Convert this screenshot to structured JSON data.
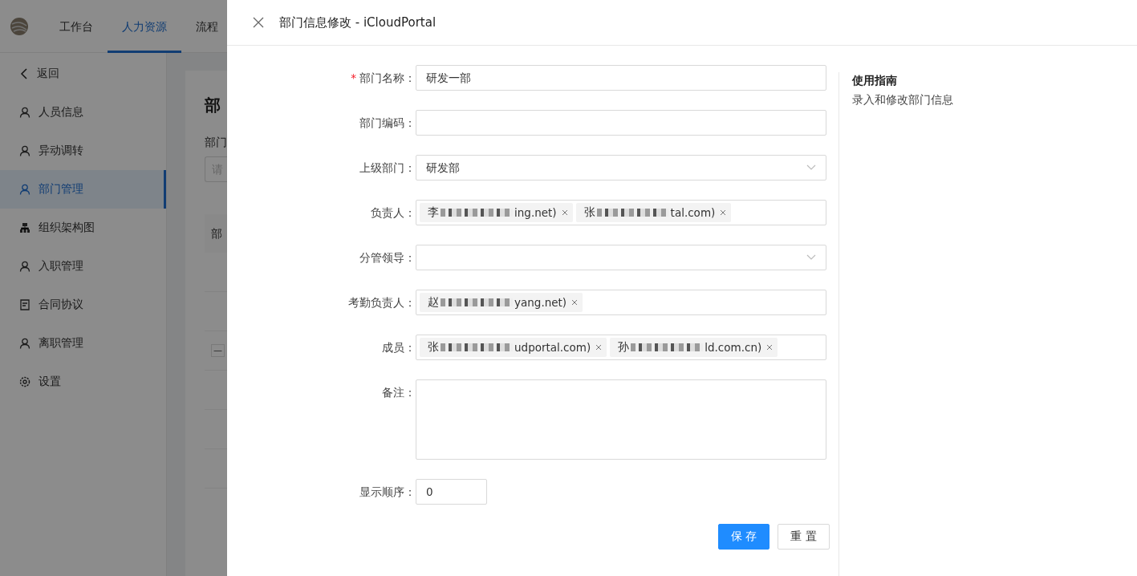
{
  "top_nav": {
    "tabs": [
      {
        "label": "工作台",
        "selected": false
      },
      {
        "label": "人力资源",
        "selected": true
      },
      {
        "label": "流程",
        "selected": false
      }
    ]
  },
  "sidebar": {
    "back": "返回",
    "items": [
      {
        "label": "人员信息",
        "kind": "person",
        "selected": false
      },
      {
        "label": "异动调转",
        "kind": "person",
        "selected": false
      },
      {
        "label": "部门管理",
        "kind": "person",
        "selected": true
      },
      {
        "label": "组织架构图",
        "kind": "org",
        "selected": false
      },
      {
        "label": "入职管理",
        "kind": "person",
        "selected": false
      },
      {
        "label": "合同协议",
        "kind": "doc",
        "selected": false
      },
      {
        "label": "离职管理",
        "kind": "person",
        "selected": false
      },
      {
        "label": "设置",
        "kind": "gear",
        "selected": false
      }
    ]
  },
  "background_page": {
    "title": "部",
    "filter_label": "部门",
    "filter_placeholder": "请",
    "table_header": "部",
    "expand_mark": "—"
  },
  "drawer": {
    "title": "部门信息修改 - iCloudPortal",
    "fields": [
      {
        "kind": "text",
        "required_mark": "*",
        "label": "部门名称：",
        "value": "研发一部"
      },
      {
        "kind": "text",
        "label": "部门编码："
      },
      {
        "kind": "select",
        "label": "上级部门：",
        "value": "研发部"
      },
      {
        "kind": "tags",
        "label": "负责人：",
        "tags": [
          {
            "prefix": "李",
            "suffix": "ing.net)"
          },
          {
            "prefix": "张",
            "suffix": "tal.com)"
          }
        ]
      },
      {
        "kind": "select",
        "label": "分管领导："
      },
      {
        "kind": "tags",
        "label": "考勤负责人：",
        "tags": [
          {
            "prefix": "赵",
            "suffix": "yang.net)"
          }
        ]
      },
      {
        "kind": "tags",
        "label": "成员：",
        "tags": [
          {
            "prefix": "张",
            "suffix": "udportal.com)"
          },
          {
            "prefix": "孙",
            "suffix": "ld.com.cn)"
          }
        ]
      },
      {
        "kind": "textarea",
        "label": "备注："
      },
      {
        "kind": "number",
        "label": "显示顺序：",
        "value": "0"
      }
    ],
    "buttons": [
      {
        "label": "保 存",
        "primary": true
      },
      {
        "label": "重 置",
        "primary": false
      }
    ],
    "guide": {
      "title": "使用指南",
      "text": "录入和修改部门信息"
    }
  }
}
